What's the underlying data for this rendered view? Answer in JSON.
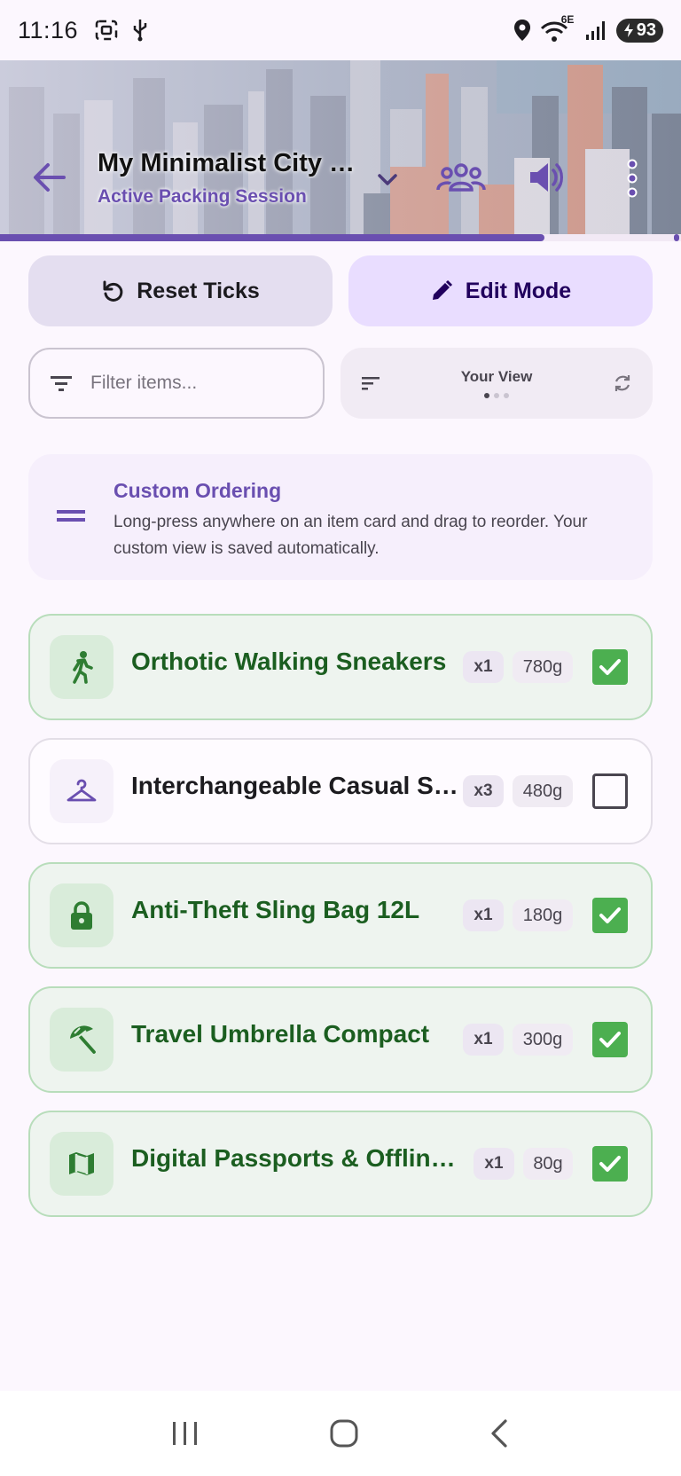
{
  "status_bar": {
    "time": "11:16",
    "network_label": "6E",
    "battery": "93",
    "icons": [
      "screenshot-icon",
      "usb-icon",
      "location-icon",
      "wifi-icon",
      "signal-icon",
      "battery-charging-icon"
    ]
  },
  "header": {
    "title": "My Minimalist City B...",
    "subtitle": "Active Packing Session",
    "progress_fraction": 0.8,
    "icons": [
      "back-arrow-icon",
      "chevron-down-icon",
      "group-icon",
      "speaker-icon",
      "more-vert-icon"
    ]
  },
  "actions": {
    "reset_label": "Reset Ticks",
    "edit_label": "Edit Mode"
  },
  "filter": {
    "placeholder": "Filter items...",
    "view_label": "Your View"
  },
  "info": {
    "title": "Custom Ordering",
    "text": "Long-press anywhere on an item card and drag to reorder. Your custom view is saved automatically."
  },
  "items": [
    {
      "name": "Orthotic Walking Sneakers",
      "qty": "x1",
      "weight": "780g",
      "checked": true,
      "icon": "walk-icon"
    },
    {
      "name": "Interchangeable Casual Sh...",
      "qty": "x3",
      "weight": "480g",
      "checked": false,
      "icon": "hanger-icon"
    },
    {
      "name": "Anti-Theft Sling Bag 12L",
      "qty": "x1",
      "weight": "180g",
      "checked": true,
      "icon": "lock-icon"
    },
    {
      "name": "Travel Umbrella Compact",
      "qty": "x1",
      "weight": "300g",
      "checked": true,
      "icon": "umbrella-icon"
    },
    {
      "name": "Digital Passports & Offline ...",
      "qty": "x1",
      "weight": "80g",
      "checked": true,
      "icon": "map-icon"
    }
  ],
  "colors": {
    "accent": "#6A4FB0",
    "checked_text": "#1B5E20",
    "checkbox_green": "#4CAF50",
    "background": "#FCF7FE"
  }
}
